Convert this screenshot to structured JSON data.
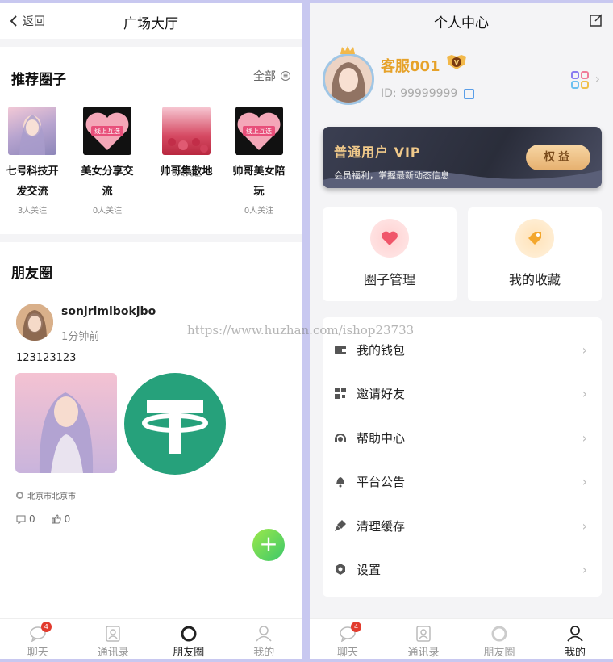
{
  "left": {
    "header": {
      "back_label": "返回",
      "title": "广场大厅"
    },
    "recommended": {
      "title": "推荐圈子",
      "all_label": "全部",
      "items": [
        {
          "name_line1": "七号科技开",
          "name_line2": "发交流",
          "follow": "3人关注"
        },
        {
          "name_line1": "美女分享交",
          "name_line2": "流",
          "follow": "0人关注",
          "thumb_text": "线上互选"
        },
        {
          "name_line1": "帅哥集散地",
          "name_line2": "",
          "follow": "0人关注"
        },
        {
          "name_line1": "帅哥美女陪",
          "name_line2": "玩",
          "follow": "0人关注",
          "thumb_text": "线上互选"
        }
      ]
    },
    "moments": {
      "title": "朋友圈",
      "post": {
        "username": "sonjrlmibokjbo",
        "time": "1分钟前",
        "text": "123123123",
        "location": "北京市北京市",
        "comments": "0",
        "likes": "0"
      }
    },
    "tabbar": [
      {
        "label": "聊天",
        "badge": "4",
        "icon": "chat-icon"
      },
      {
        "label": "通讯录",
        "icon": "contacts-icon"
      },
      {
        "label": "朋友圈",
        "icon": "moments-icon"
      },
      {
        "label": "我的",
        "icon": "profile-icon"
      }
    ]
  },
  "right": {
    "header": {
      "title": "个人中心"
    },
    "profile": {
      "name": "客服001",
      "id": "ID: 99999999",
      "level_badge": "V"
    },
    "vip": {
      "title": "普通用户 VIP",
      "subtitle": "会员福利，掌握最新动态信息",
      "button": "权益"
    },
    "quick": [
      {
        "label": "圈子管理",
        "icon": "heart-icon"
      },
      {
        "label": "我的收藏",
        "icon": "tag-icon"
      }
    ],
    "menu": [
      {
        "label": "我的钱包",
        "icon": "wallet-icon"
      },
      {
        "label": "邀请好友",
        "icon": "qrcode-icon"
      },
      {
        "label": "帮助中心",
        "icon": "headset-icon"
      },
      {
        "label": "平台公告",
        "icon": "bell-icon"
      },
      {
        "label": "清理缓存",
        "icon": "broom-icon"
      },
      {
        "label": "设置",
        "icon": "settings-icon"
      }
    ],
    "tabbar": [
      {
        "label": "聊天",
        "badge": "4",
        "icon": "chat-icon"
      },
      {
        "label": "通讯录",
        "icon": "contacts-icon"
      },
      {
        "label": "朋友圈",
        "icon": "moments-icon"
      },
      {
        "label": "我的",
        "icon": "profile-icon"
      }
    ]
  },
  "watermark": "https://www.huzhan.com/ishop23733",
  "colors": {
    "accent_green": "#3cc86a",
    "gold": "#e6a22a",
    "tether_green": "#26a17b",
    "badge_red": "#e23b2e"
  }
}
